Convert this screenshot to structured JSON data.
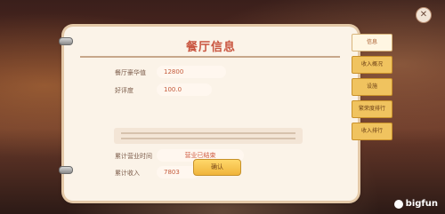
{
  "panel": {
    "title": "餐厅信息",
    "rows": [
      {
        "label": "餐厅豪华值",
        "value": "12800"
      },
      {
        "label": "好评度",
        "value": "100.0"
      },
      {
        "label": "累计营业时间",
        "value": "营业已结束"
      },
      {
        "label": "累计收入",
        "value": "7803"
      }
    ],
    "action_button": "确认"
  },
  "tabs": [
    {
      "label": "信息",
      "active": true
    },
    {
      "label": "收入概况",
      "active": false
    },
    {
      "label": "设施",
      "active": false
    },
    {
      "label": "繁荣度排行",
      "active": false
    },
    {
      "label": "收入排行",
      "active": false
    }
  ],
  "logo": {
    "text": "bigfun"
  },
  "icons": {
    "close": "close-icon"
  }
}
